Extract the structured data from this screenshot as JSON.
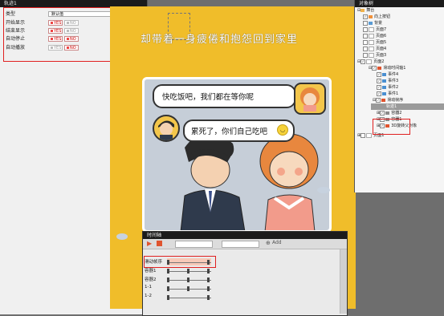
{
  "left_panel": {
    "title": "轨迹1",
    "rows": [
      {
        "label": "类型",
        "value": "默认值"
      },
      {
        "label": "开始显示",
        "yes": "YES",
        "no": "NO",
        "active": "no"
      },
      {
        "label": "结束显示",
        "yes": "YES",
        "no": "NO",
        "active": "yes"
      },
      {
        "label": "自动停止",
        "yes": "YES",
        "no": "NO",
        "active": "no"
      },
      {
        "label": "自动播放",
        "yes": "YES",
        "no": "NO",
        "active": "no"
      }
    ]
  },
  "stage": {
    "heading": "却带着一身疲倦和抱怨回到家里",
    "bubble1": "快吃饭吧，我们都在等你呢",
    "bubble2": "累死了，你们自己吃吧"
  },
  "right_panel": {
    "title": "对象树",
    "items": [
      {
        "label": "舞台",
        "level": 0
      },
      {
        "label": "向上按钮",
        "level": 1
      },
      {
        "label": "背景",
        "level": 1
      },
      {
        "label": "页面7",
        "level": 1
      },
      {
        "label": "页面6",
        "level": 1
      },
      {
        "label": "页面5",
        "level": 1
      },
      {
        "label": "页面4",
        "level": 1
      },
      {
        "label": "页面3",
        "level": 1
      },
      {
        "label": "页面2",
        "level": 1
      },
      {
        "label": "滑动时间轴1",
        "level": 2
      },
      {
        "label": "事件4",
        "level": 3
      },
      {
        "label": "事件3",
        "level": 3
      },
      {
        "label": "事件2",
        "level": 3
      },
      {
        "label": "事件1",
        "level": 3
      },
      {
        "label": "滑动帧序",
        "level": 3
      },
      {
        "label": "轨迹1",
        "level": 4
      },
      {
        "label": "容器2",
        "level": 3
      },
      {
        "label": "容器1",
        "level": 3
      },
      {
        "label": "3D旋转父对象",
        "level": 3
      },
      {
        "label": "页面1",
        "level": 1
      }
    ]
  },
  "timeline": {
    "title": "时间轴",
    "add_label": "Add",
    "rows": [
      "滑动帧序",
      "容器1",
      "容器2",
      "1-1",
      "1-2"
    ]
  }
}
